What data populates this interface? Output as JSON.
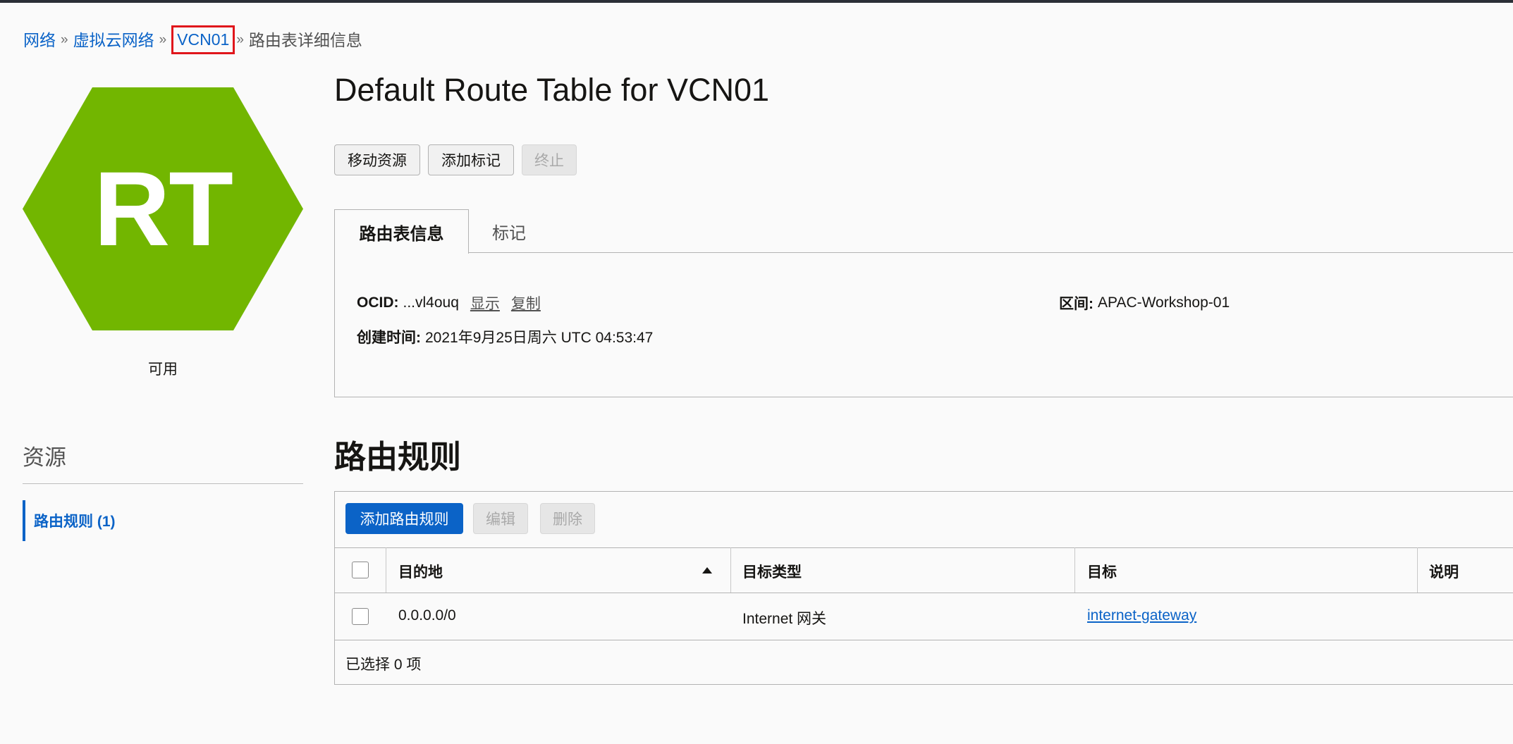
{
  "breadcrumb": {
    "items": [
      "网络",
      "虚拟云网络",
      "VCN01"
    ],
    "current": "路由表详细信息",
    "separator": "»"
  },
  "resource": {
    "icon_text": "RT",
    "icon_shape": "hexagon",
    "icon_color": "#72b600",
    "status": "可用"
  },
  "page": {
    "title": "Default Route Table for VCN01"
  },
  "actions": {
    "move_label": "移动资源",
    "add_tags_label": "添加标记",
    "terminate_label": "终止"
  },
  "tabs": {
    "info_label": "路由表信息",
    "tags_label": "标记"
  },
  "info": {
    "ocid_label": "OCID:",
    "ocid_value": "...vl4ouq",
    "show_label": "显示",
    "copy_label": "复制",
    "compartment_label": "区间:",
    "compartment_value": "APAC-Workshop-01",
    "created_label": "创建时间:",
    "created_value": "2021年9月25日周六 UTC 04:53:47"
  },
  "sidebar": {
    "title": "资源",
    "items": [
      {
        "label": "路由规则 (1)"
      }
    ]
  },
  "rules": {
    "title": "路由规则",
    "add_label": "添加路由规则",
    "edit_label": "编辑",
    "delete_label": "删除",
    "columns": [
      "目的地",
      "目标类型",
      "目标",
      "说明"
    ],
    "rows": [
      {
        "destination": "0.0.0.0/0",
        "target_type": "Internet 网关",
        "target": "internet-gateway",
        "description": ""
      }
    ],
    "selected_text": "已选择 0 项"
  },
  "colors": {
    "accent": "#0b63c7",
    "highlight_box": "#e0161b"
  }
}
